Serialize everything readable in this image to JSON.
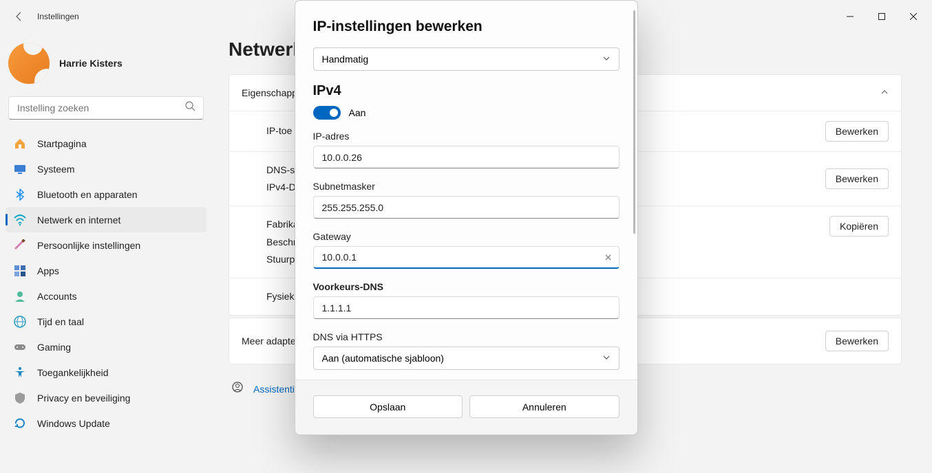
{
  "titlebar": {
    "appTitle": "Instellingen"
  },
  "profile": {
    "name": "Harrie Kisters"
  },
  "search": {
    "placeholder": "Instelling zoeken"
  },
  "sidebar": {
    "items": [
      {
        "label": "Startpagina",
        "name": "sidebar-home",
        "iconColor": "#f2a33c"
      },
      {
        "label": "Systeem",
        "name": "sidebar-system",
        "iconColor": "#3a7fd5"
      },
      {
        "label": "Bluetooth en apparaten",
        "name": "sidebar-bluetooth",
        "iconColor": "#1e90ff"
      },
      {
        "label": "Netwerk en internet",
        "name": "sidebar-network",
        "iconColor": "#00a3c4",
        "active": true
      },
      {
        "label": "Persoonlijke instellingen",
        "name": "sidebar-personalization",
        "iconColor": "#d47fad"
      },
      {
        "label": "Apps",
        "name": "sidebar-apps",
        "iconColor": "#5a8dd6"
      },
      {
        "label": "Accounts",
        "name": "sidebar-accounts",
        "iconColor": "#4fbb9c"
      },
      {
        "label": "Tijd en taal",
        "name": "sidebar-time-language",
        "iconColor": "#2c9dc1"
      },
      {
        "label": "Gaming",
        "name": "sidebar-gaming",
        "iconColor": "#8a8a8a"
      },
      {
        "label": "Toegankelijkheid",
        "name": "sidebar-accessibility",
        "iconColor": "#1d85c6"
      },
      {
        "label": "Privacy en beveiliging",
        "name": "sidebar-privacy",
        "iconColor": "#9b9b9b"
      },
      {
        "label": "Windows Update",
        "name": "sidebar-windows-update",
        "iconColor": "#1d85c6"
      }
    ]
  },
  "main": {
    "pageTitle": "Netwerk",
    "propertiesHeader": "Eigenschappen",
    "rows": {
      "ip": {
        "label": "IP-toe",
        "button": "Bewerken"
      },
      "dns": {
        "label1": "DNS-s",
        "label2": "IPv4-D",
        "button": "Bewerken"
      },
      "mfg": {
        "label1": "Fabrika",
        "label2": "Beschr",
        "label3": "Stuurp",
        "button": "Kopiëren"
      },
      "phys": {
        "label": "Fysiek"
      }
    },
    "moreAdapters": {
      "label": "Meer adapter",
      "button": "Bewerken"
    },
    "helpLink": "Assistentie"
  },
  "dialog": {
    "title": "IP-instellingen bewerken",
    "modeSelect": "Handmatig",
    "ipv4": {
      "heading": "IPv4",
      "toggleLabel": "Aan",
      "ipLabel": "IP-adres",
      "ipValue": "10.0.0.26",
      "subnetLabel": "Subnetmasker",
      "subnetValue": "255.255.255.0",
      "gatewayLabel": "Gateway",
      "gatewayValue": "10.0.0.1",
      "preferredDnsLabel": "Voorkeurs-DNS",
      "preferredDnsValue": "1.1.1.1",
      "dnsOverHttpsLabel": "DNS via HTTPS",
      "dnsOverHttpsValue": "Aan (automatische sjabloon)"
    },
    "save": "Opslaan",
    "cancel": "Annuleren"
  }
}
